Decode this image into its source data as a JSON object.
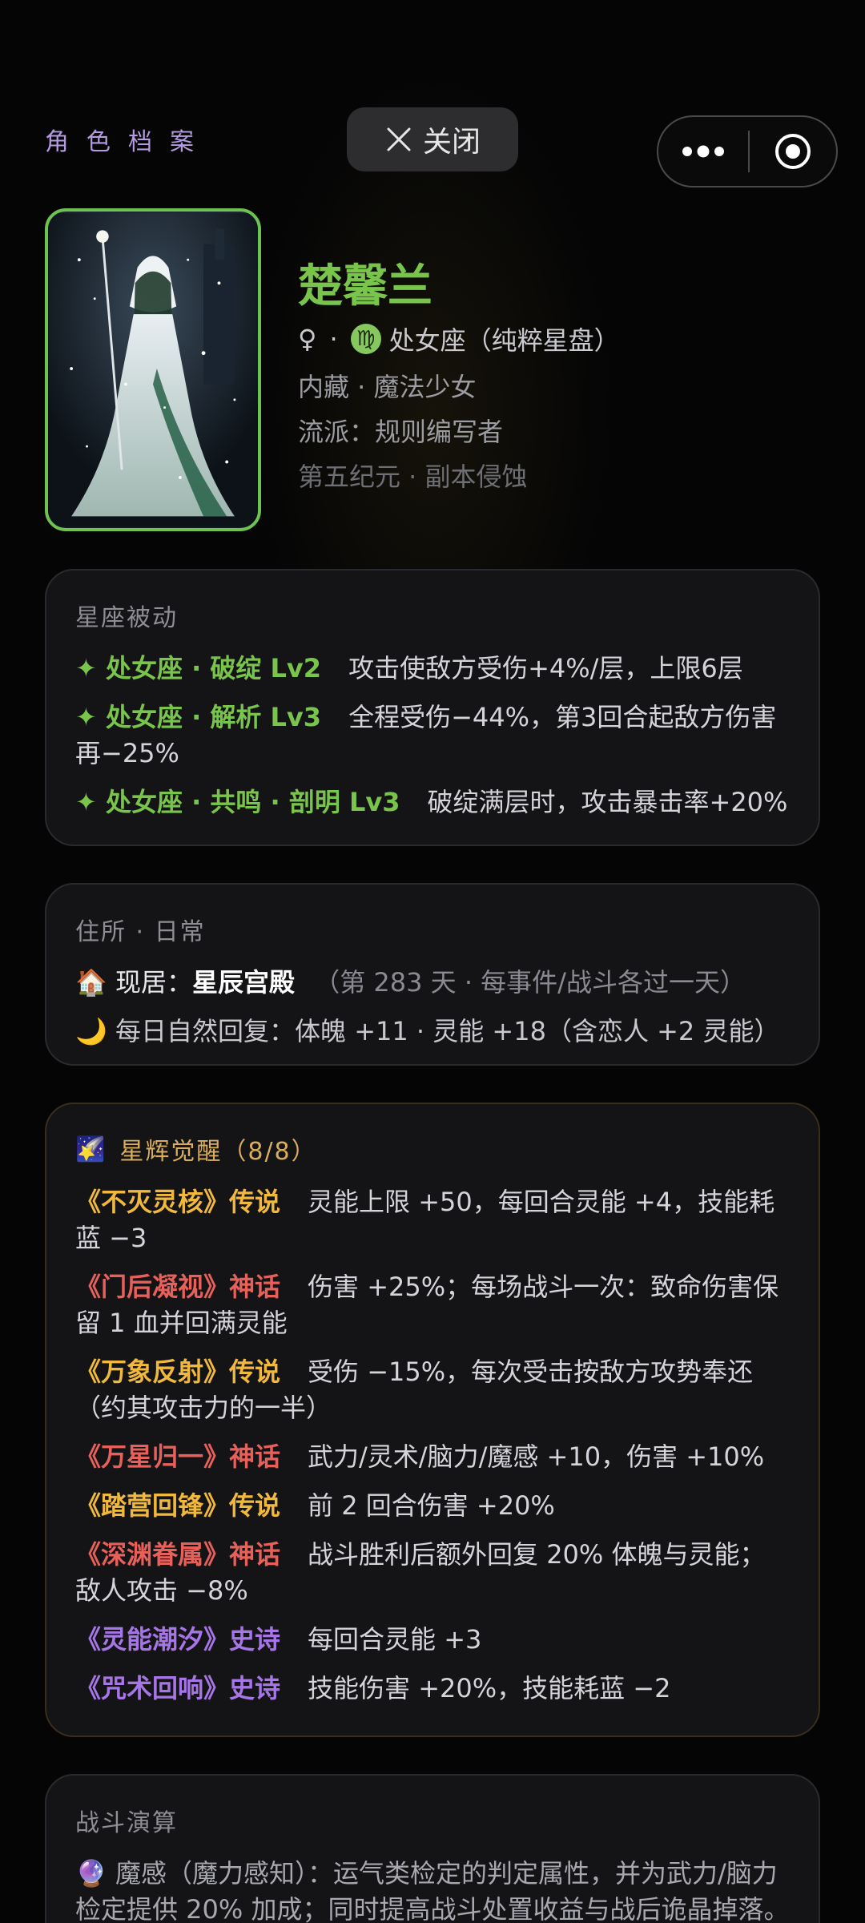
{
  "header": {
    "archive_title": "角色档案",
    "close_label": "关闭"
  },
  "profile": {
    "name": "楚馨兰",
    "gender_symbol": "♀",
    "sep": "·",
    "zodiac_glyph": "♍",
    "zodiac": "处女座（纯粹星盘）",
    "line2": "内藏 · 魔法少女",
    "line3": "流派：规则编写者",
    "line4": "第五纪元  ·  副本侵蚀"
  },
  "passive": {
    "title": "星座被动",
    "items": [
      {
        "tag": "✦ 处女座 · 破绽 Lv2",
        "desc": "攻击使敌方受伤+4%/层，上限6层"
      },
      {
        "tag": "✦ 处女座 · 解析 Lv3",
        "desc": "全程受伤−44%，第3回合起敌方伤害再−25%"
      },
      {
        "tag": "✦ 处女座 · 共鸣 · 剖明 Lv3",
        "desc": "破绽满层时，攻击暴击率+20%"
      }
    ]
  },
  "residence": {
    "title": "住所  ·  日常",
    "home_icon": "🏠",
    "home_label": "现居：",
    "home_value": "星辰宫殿",
    "home_note": "（第 283 天  ·  每事件/战斗各过一天）",
    "moon_icon": "🌙",
    "recovery": "每日自然回复：体魄 +11  ·  灵能 +18（含恋人 +2 灵能）"
  },
  "awakening": {
    "icon": "🌠",
    "title": "星辉觉醒（8/8）",
    "items": [
      {
        "tag": "《不灭灵核》传说",
        "color": "gold",
        "desc": "灵能上限 +50，每回合灵能 +4，技能耗蓝 −3"
      },
      {
        "tag": "《门后凝视》神话",
        "color": "red",
        "desc": "伤害 +25%；每场战斗一次：致命伤害保留 1 血并回满灵能"
      },
      {
        "tag": "《万象反射》传说",
        "color": "gold",
        "desc": "受伤 −15%，每次受击按敌方攻势奉还（约其攻击力的一半）"
      },
      {
        "tag": "《万星归一》神话",
        "color": "red",
        "desc": "武力/灵术/脑力/魔感 +10，伤害 +10%"
      },
      {
        "tag": "《踏营回锋》传说",
        "color": "gold",
        "desc": "前 2 回合伤害 +20%"
      },
      {
        "tag": "《深渊眷属》神话",
        "color": "red",
        "desc": "战斗胜利后额外回复 20% 体魄与灵能；敌人攻击 −8%"
      },
      {
        "tag": "《灵能潮汐》史诗",
        "color": "purple",
        "desc": "每回合灵能 +3"
      },
      {
        "tag": "《咒术回响》史诗",
        "color": "purple",
        "desc": "技能伤害 +20%，技能耗蓝 −2"
      }
    ]
  },
  "combat": {
    "title": "战斗演算",
    "icon": "🔮",
    "text": "魔感（魔力感知）：运气类检定的判定属性，并为武力/脑力检定提供 20% 加成；同时提高战斗处置收益与战后诡晶掉落。"
  },
  "colors": {
    "accent_green": "#79c54c",
    "legend_gold": "#f0b93e",
    "myth_red": "#e8605a",
    "epic_purple": "#a776e6"
  }
}
